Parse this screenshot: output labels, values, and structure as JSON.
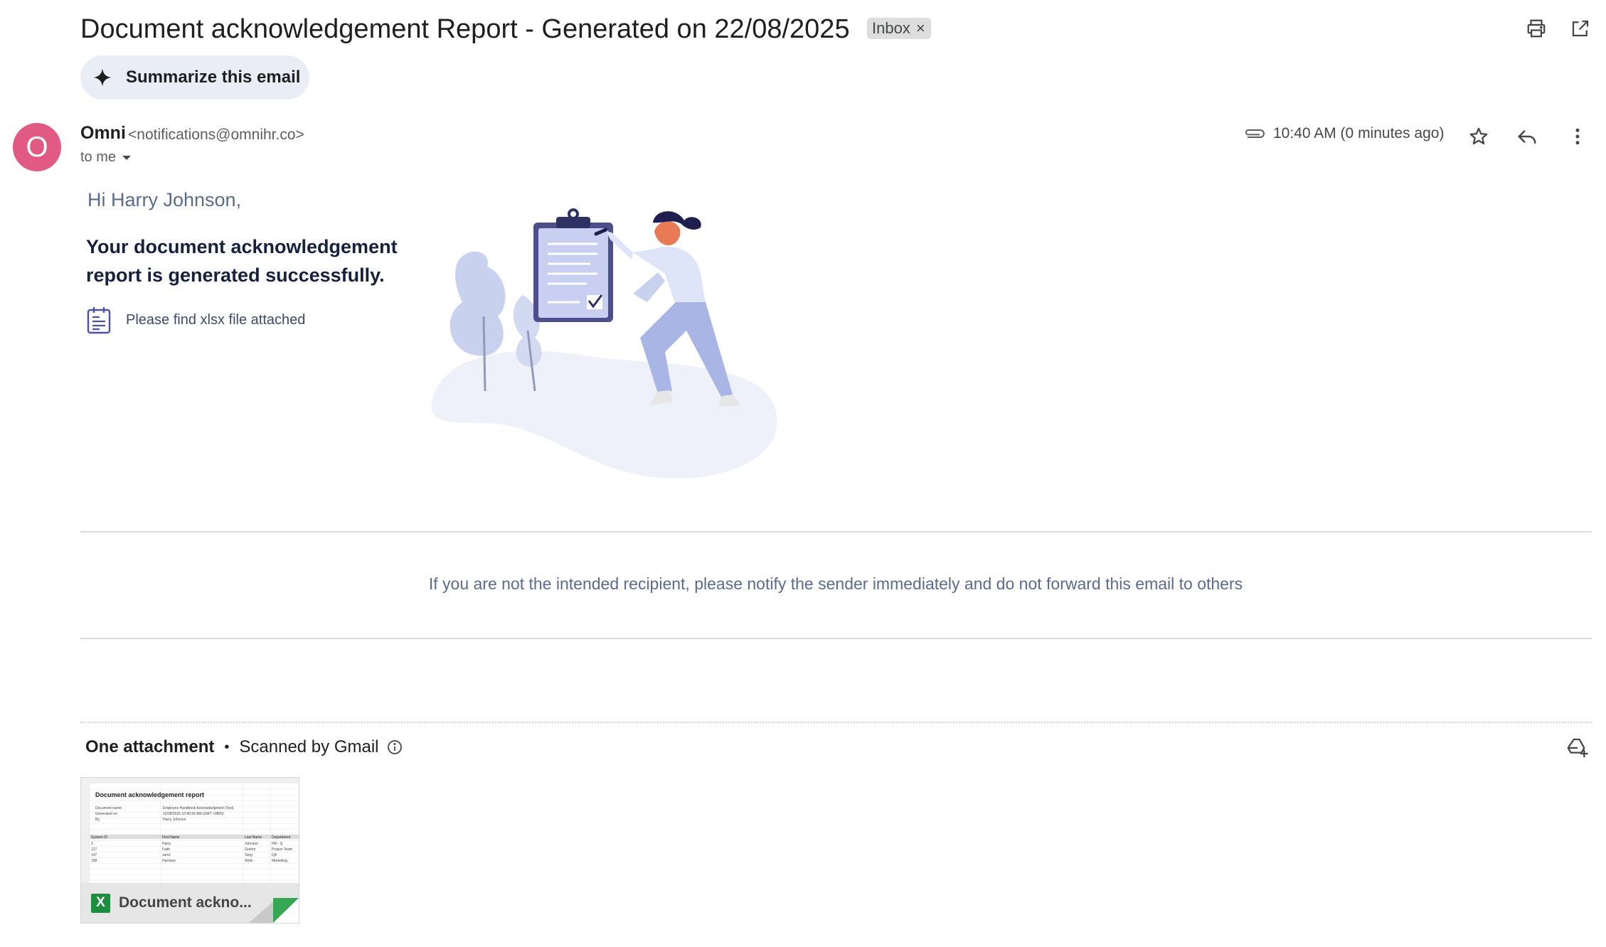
{
  "email": {
    "subject": "Document acknowledgement Report - Generated on 22/08/2025",
    "label": "Inbox",
    "label_remove": "×",
    "summarize_label": "Summarize this email",
    "sender": {
      "avatar_letter": "O",
      "name": "Omni",
      "email": "<notifications@omnihr.co>",
      "to": "to me"
    },
    "time": "10:40 AM (0 minutes ago)"
  },
  "body": {
    "greeting": "Hi Harry Johnson,",
    "headline": "Your document acknowledgement report is generated successfully.",
    "attachment_note": "Please find xlsx file attached",
    "footer_note": "If you are not the intended recipient, please notify the sender immediately and do not forward this email to others"
  },
  "attachments": {
    "count_label": "One attachment",
    "separator": "•",
    "scanned_label": "Scanned by Gmail",
    "file": {
      "type_badge": "X",
      "name": "Document ackno...",
      "preview": {
        "title": "Document acknowledgement report",
        "meta": [
          [
            "Document name:",
            "Employee Handbook Acknowledgment (Test)"
          ],
          [
            "Generated on:",
            "22/08/2025 10:40:56 AM (GMT +0800)"
          ],
          [
            "By:",
            "Harry Johnson"
          ]
        ],
        "columns": [
          "System ID",
          "First Name",
          "Last Name",
          "Department"
        ],
        "rows": [
          [
            "3",
            "Harry",
            "Johnson",
            "HR - Q"
          ],
          [
            "127",
            "Faith",
            "Grahm",
            "Project Team"
          ],
          [
            "147",
            "Jamii",
            "Tang",
            "QA"
          ],
          [
            "198",
            "Harrison",
            "Wolk",
            "Marketing"
          ]
        ]
      }
    }
  },
  "colors": {
    "avatar": "#e05a84",
    "summarize_bg": "#e9eef6",
    "body_text": "#5b6b8c",
    "headline": "#16213e",
    "excel_green": "#1e8e3e"
  },
  "icons": [
    "sparkle-icon",
    "print-icon",
    "open-in-new-window-icon",
    "paperclip-icon",
    "star-icon",
    "reply-icon",
    "more-vert-icon",
    "chevron-down-icon",
    "document-list-icon",
    "info-icon",
    "add-to-drive-icon",
    "excel-icon"
  ]
}
